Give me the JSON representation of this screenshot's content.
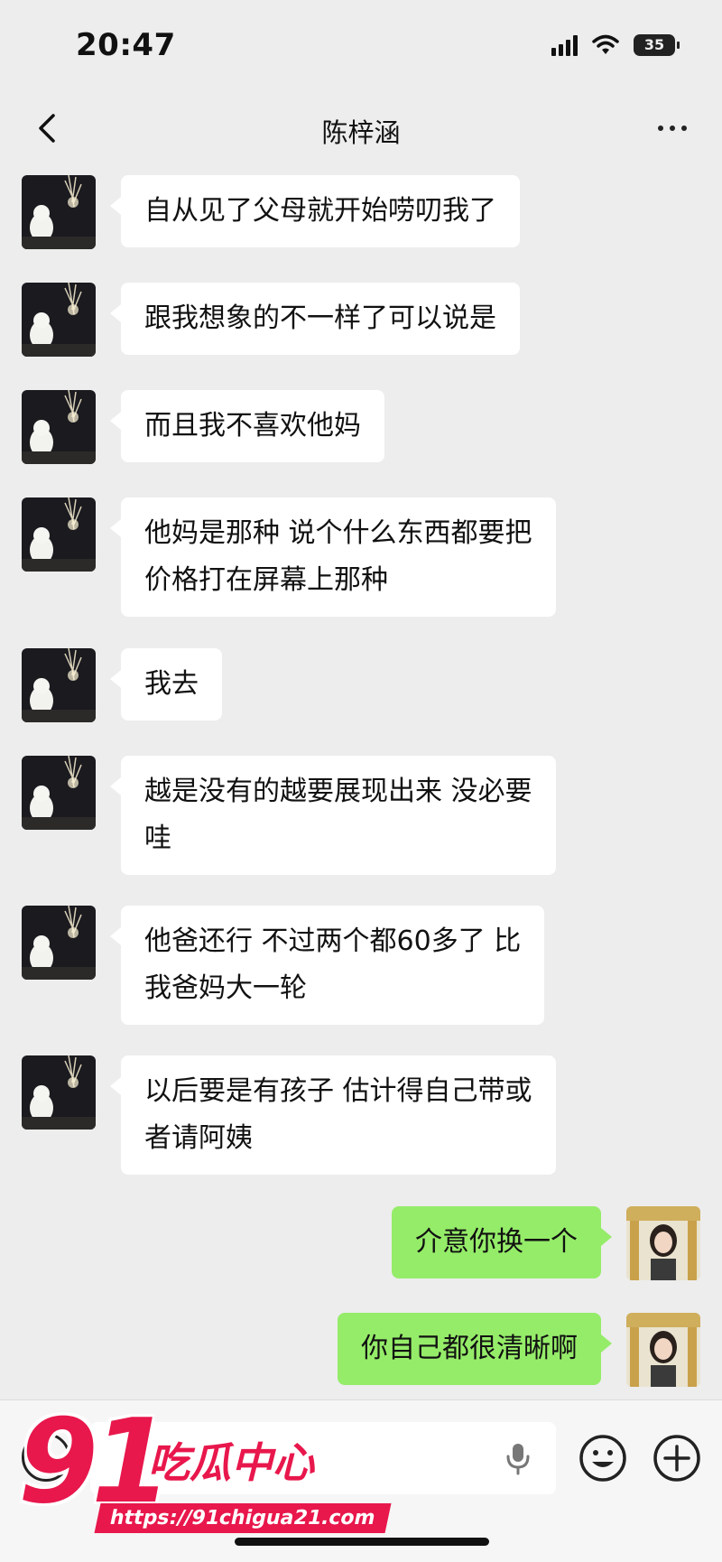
{
  "status_bar": {
    "time": "20:47",
    "battery": "35"
  },
  "nav": {
    "title": "陈梓涵"
  },
  "messages": [
    {
      "side": "in",
      "lines": [
        "自从见了父母就开始唠叨我了"
      ]
    },
    {
      "side": "in",
      "lines": [
        "跟我想象的不一样了可以说是"
      ]
    },
    {
      "side": "in",
      "lines": [
        "而且我不喜欢他妈"
      ]
    },
    {
      "side": "in",
      "lines": [
        "他妈是那种 说个什么东西都要把",
        "价格打在屏幕上那种"
      ]
    },
    {
      "side": "in",
      "lines": [
        "我去"
      ]
    },
    {
      "side": "in",
      "lines": [
        "越是没有的越要展现出来 没必要",
        "哇"
      ]
    },
    {
      "side": "in",
      "lines": [
        "他爸还行 不过两个都60多了 比",
        "我爸妈大一轮"
      ]
    },
    {
      "side": "in",
      "lines": [
        "以后要是有孩子 估计得自己带或",
        "者请阿姨"
      ]
    },
    {
      "side": "out",
      "lines": [
        "介意你换一个"
      ]
    },
    {
      "side": "out",
      "lines": [
        "你自己都很清晰啊"
      ]
    }
  ],
  "watermark": {
    "number": "91",
    "name": "吃瓜中心",
    "url": "https://91chigua21.com"
  },
  "colors": {
    "background": "#ededed",
    "outgoing_bubble": "#95ec69",
    "incoming_bubble": "#ffffff",
    "watermark": "#e8174c"
  },
  "icons": [
    "back-chevron-icon",
    "more-icon",
    "signal-icon",
    "wifi-icon",
    "battery-icon",
    "voice-icon",
    "mic-icon",
    "emoji-icon",
    "plus-icon"
  ]
}
